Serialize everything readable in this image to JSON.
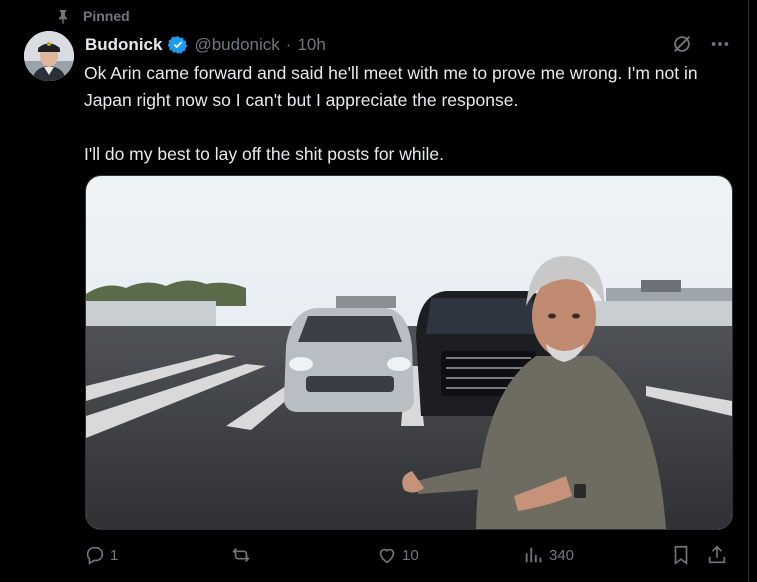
{
  "pinned": {
    "label": "Pinned"
  },
  "author": {
    "name": "Budonick",
    "handle": "@budonick",
    "separator": "·",
    "time": "10h"
  },
  "tweet": {
    "paragraph_1": "Ok Arin came forward and said he'll meet with me to prove me wrong. I'm not in Japan right now so I can't but I appreciate the response.",
    "paragraph_2": "I'll do my best to lay off the shit posts for while."
  },
  "metrics": {
    "replies": "1",
    "retweets": "",
    "likes": "10",
    "views": "340"
  },
  "colors": {
    "background": "#000000",
    "text": "#e7e9ea",
    "muted": "#71767b",
    "verified": "#1d9bf0"
  },
  "icons": [
    "pin-icon",
    "verified-badge-icon",
    "grok-icon",
    "more-icon",
    "reply-icon",
    "retweet-icon",
    "like-icon",
    "views-icon",
    "bookmark-icon",
    "share-icon"
  ]
}
